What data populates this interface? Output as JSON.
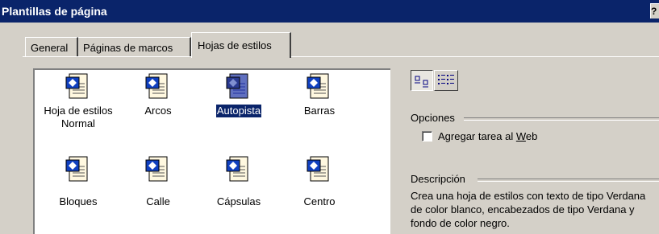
{
  "window": {
    "title": "Plantillas de página",
    "help_label": "?"
  },
  "tabs": [
    {
      "label": "General",
      "active": false
    },
    {
      "label": "Páginas de marcos",
      "active": false
    },
    {
      "label": "Hojas de estilos",
      "active": true
    }
  ],
  "templates": [
    {
      "label": "Hoja de estilos Normal",
      "icon": "stylesheet-icon",
      "selected": false
    },
    {
      "label": "Arcos",
      "icon": "stylesheet-icon",
      "selected": false
    },
    {
      "label": "Autopista",
      "icon": "stylesheet-icon",
      "selected": true
    },
    {
      "label": "Barras",
      "icon": "stylesheet-icon",
      "selected": false
    },
    {
      "label": "Bloques",
      "icon": "stylesheet-icon",
      "selected": false
    },
    {
      "label": "Calle",
      "icon": "stylesheet-icon",
      "selected": false
    },
    {
      "label": "Cápsulas",
      "icon": "stylesheet-icon",
      "selected": false
    },
    {
      "label": "Centro",
      "icon": "stylesheet-icon",
      "selected": false
    }
  ],
  "view_buttons": [
    {
      "name": "large-icons-view-icon",
      "active": true
    },
    {
      "name": "list-view-icon",
      "active": false
    }
  ],
  "options": {
    "title": "Opciones",
    "checkbox_label": "Agregar tarea al Web",
    "checkbox_accel": "W",
    "checked": false
  },
  "description": {
    "title": "Descripción",
    "text": "Crea una hoja de estilos con texto de tipo Verdana de color blanco, encabezados de tipo Verdana y fondo de color negro."
  },
  "colors": {
    "titlebar": "#0a246a",
    "selection": "#0a246a",
    "face": "#d4d0c8"
  }
}
